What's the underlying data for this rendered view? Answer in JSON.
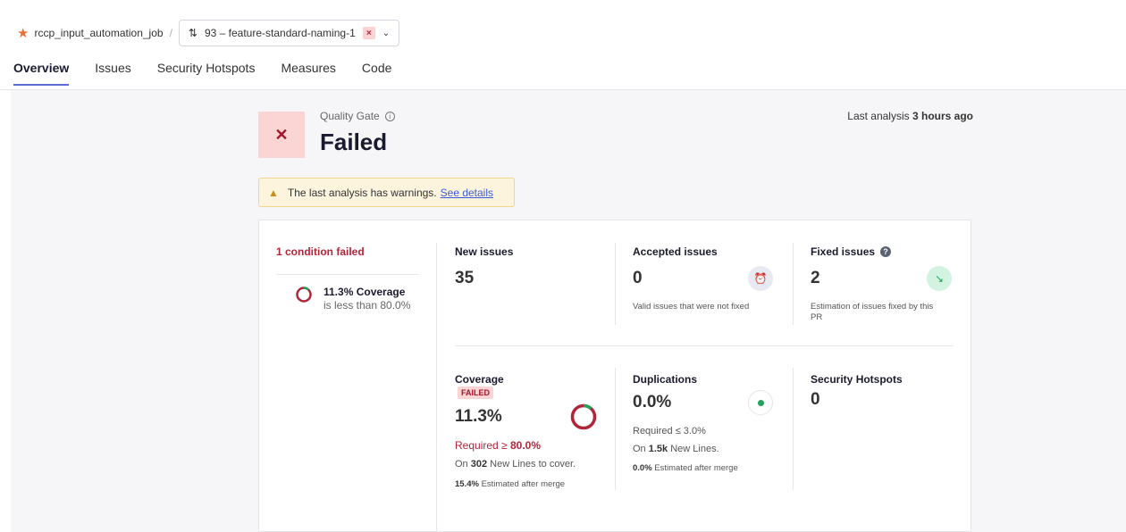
{
  "breadcrumb": {
    "project": "rccp_input_automation_job",
    "separator": "/",
    "pull_request": "93 – feature-standard-naming-1"
  },
  "tabs": [
    {
      "label": "Overview",
      "active": true
    },
    {
      "label": "Issues",
      "active": false
    },
    {
      "label": "Security Hotspots",
      "active": false
    },
    {
      "label": "Measures",
      "active": false
    },
    {
      "label": "Code",
      "active": false
    }
  ],
  "quality_gate": {
    "label": "Quality Gate",
    "status": "Failed"
  },
  "last_analysis": {
    "prefix": "Last analysis",
    "value": "3 hours ago"
  },
  "warning": {
    "text": "The last analysis has warnings.",
    "link": "See details"
  },
  "conditions": {
    "title": "1 condition failed",
    "items": [
      {
        "metric": "11.3% Coverage",
        "detail": "is less than 80.0%"
      }
    ]
  },
  "metrics": {
    "new_issues": {
      "title": "New issues",
      "value": "35"
    },
    "accepted_issues": {
      "title": "Accepted issues",
      "value": "0",
      "subtitle": "Valid issues that were not fixed"
    },
    "fixed_issues": {
      "title": "Fixed issues",
      "value": "2",
      "subtitle_line1": "Estimation of issues fixed by this",
      "subtitle_line2": "PR"
    },
    "coverage": {
      "title": "Coverage",
      "badge": "FAILED",
      "value": "11.3%",
      "fraction": 0.113,
      "required_prefix": "Required ≥",
      "required_value": "80.0%",
      "lines_prefix": "On",
      "lines_value": "302",
      "lines_suffix": "New Lines to cover.",
      "estimate_value": "15.4%",
      "estimate_suffix": "Estimated after merge"
    },
    "duplications": {
      "title": "Duplications",
      "value": "0.0%",
      "required": "Required ≤ 3.0%",
      "lines_prefix": "On",
      "lines_value": "1.5k",
      "lines_suffix": "New Lines.",
      "estimate_value": "0.0%",
      "estimate_suffix": "Estimated after merge"
    },
    "security_hotspots": {
      "title": "Security Hotspots",
      "value": "0"
    }
  },
  "colors": {
    "failed_red": "#b22539",
    "accent": "#5d6cd0",
    "success_green": "#1fa35b"
  }
}
